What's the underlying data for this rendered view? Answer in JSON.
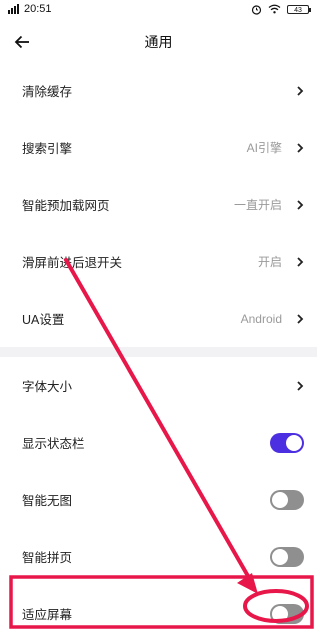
{
  "status_bar": {
    "time": "20:51",
    "signal": "4G",
    "battery": "43"
  },
  "header": {
    "title": "通用"
  },
  "settings": {
    "clear_cache": {
      "label": "清除缓存"
    },
    "search_engine": {
      "label": "搜索引擎",
      "value": "AI引擎"
    },
    "preload": {
      "label": "智能预加载网页",
      "value": "一直开启"
    },
    "swipe_nav": {
      "label": "滑屏前进后退开关",
      "value": "开启"
    },
    "ua": {
      "label": "UA设置",
      "value": "Android"
    },
    "font_size": {
      "label": "字体大小"
    },
    "show_status_bar": {
      "label": "显示状态栏",
      "enabled": true
    },
    "smart_no_image": {
      "label": "智能无图",
      "enabled": false
    },
    "smart_paging": {
      "label": "智能拼页",
      "enabled": false
    },
    "fit_screen": {
      "label": "适应屏幕",
      "enabled": false
    }
  },
  "colors": {
    "toggle_on": "#4b2fe0",
    "toggle_off": "#8f8f8f",
    "annotation": "#e8174a"
  }
}
